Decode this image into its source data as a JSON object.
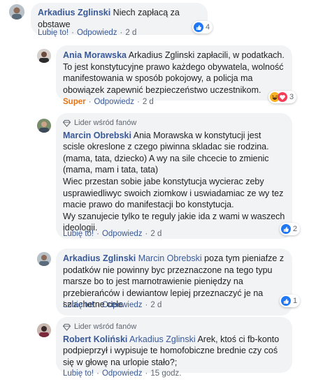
{
  "comments": [
    {
      "author": "Arkadius Zglinski",
      "segments": [
        {
          "text": " Niech zapłacą za obstawe",
          "type": "text"
        }
      ],
      "like": "Lubię to!",
      "reply": "Odpowiedz",
      "time": "2 d",
      "reaction_count": "4"
    },
    {
      "author": "Ania Morawska",
      "segments": [
        {
          "text": " Arkadius Zglinski zapłacili, w podatkach. To jest konstytucyjne prawo każdego obywatela, wolność manifestowania w sposób pokojowy, a policja ma obowiązek zapewnić bezpieczeństwo uczestnikom.",
          "type": "text"
        }
      ],
      "like": "Super",
      "reply": "Odpowiedz",
      "time": "2 d",
      "reaction_count": "3"
    },
    {
      "badge": "Lider wśród fanów",
      "author": "Marcin Obrebski",
      "segments": [
        {
          "text": " Ania Morawska w konstytucji jest scisle okreslone z czego piwinna skladac sie rodzina. (mama, tata, dziecko) A wy na sile chcecie to zmienic (mama, mam i tata, tata)\nWiec przestan sobie jabe konstytucja wycierac zeby usprawiedliwyc swoich ziomkow i uswiadamiac ze wy tez macie prawo do manifestacji bo konstytucja.\nWy szanujecie tylko te reguly jakie ida z wami w waszech ideologii.",
          "type": "text"
        }
      ],
      "like": "Lubię to!",
      "reply": "Odpowiedz",
      "time": "2 d",
      "reaction_count": "2"
    },
    {
      "author": "Arkadius Zglinski",
      "mention": "Marcin Obrebski",
      "segments": [
        {
          "text": " poza tym pieniafze z podatków nie powinny byc przeznaczone na tego typu marsze bo to jest marnotrawienie pieniędzy na przebierańców i dewiantow lepiej przeznaczyć je na szlachetne cele",
          "type": "text"
        }
      ],
      "like": "Lubię to!",
      "reply": "Odpowiedz",
      "time": "2 d",
      "reaction_count": "1"
    },
    {
      "badge": "Lider wśród fanów",
      "author": "Robert Koliński",
      "mention": "Arkadius Zglinski",
      "segments": [
        {
          "text": " Arek, ktoś ci fb-konto podpieprzył i wypisuje te homofobiczne brednie czy coś się w głowę na urlopie stało?;",
          "type": "text"
        }
      ],
      "like": "Lubię to!",
      "reply": "Odpowiedz",
      "time": "15 godz."
    }
  ],
  "colors": {
    "link": "#385898",
    "bubble": "#f2f3f5",
    "like": "#2078f4",
    "super": "#e9710f"
  }
}
